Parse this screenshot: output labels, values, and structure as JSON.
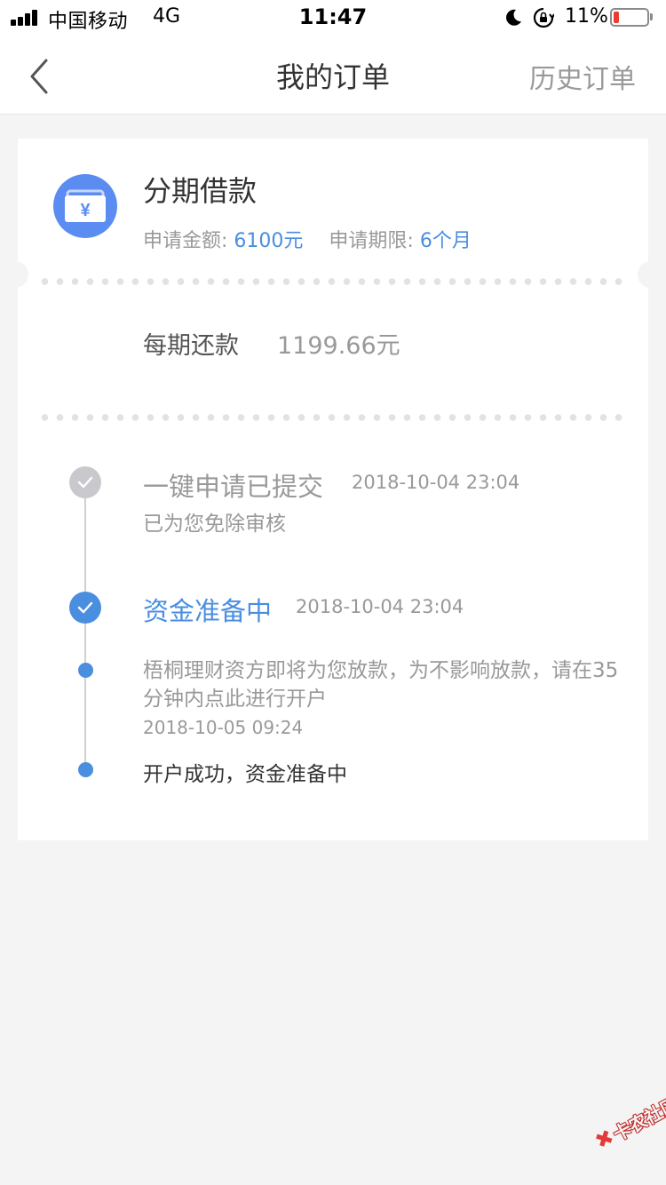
{
  "status_bar": {
    "carrier": "中国移动",
    "network": "4G",
    "time": "11:47",
    "battery_percent": "11%",
    "icons": [
      "signal-icon",
      "moon-icon",
      "rotation-lock-icon",
      "battery-icon"
    ]
  },
  "nav": {
    "back_icon": "chevron-left-icon",
    "title": "我的订单",
    "history_label": "历史订单"
  },
  "loan": {
    "icon": "wallet-yuan-icon",
    "title": "分期借款",
    "amount_label": "申请金额:",
    "amount_value": "6100元",
    "term_label": "申请期限:",
    "term_value": "6个月",
    "repay_label": "每期还款",
    "repay_value": "1199.66元"
  },
  "timeline": {
    "step1": {
      "title": "一键申请已提交",
      "time": "2018-10-04 23:04",
      "subtitle": "已为您免除审核"
    },
    "step2": {
      "title": "资金准备中",
      "time": "2018-10-04 23:04",
      "sub1": {
        "text": "梧桐理财资方即将为您放款，为不影响放款，请在35分钟内点此进行开户",
        "time": "2018-10-05 09:24"
      },
      "sub2": {
        "text": "开户成功，资金准备中"
      }
    }
  },
  "watermark": {
    "text": "卡农社区"
  },
  "colors": {
    "accent": "#4a8ee0",
    "icon_blue": "#5b8cf2",
    "muted": "#999999",
    "background": "#f4f4f4"
  }
}
